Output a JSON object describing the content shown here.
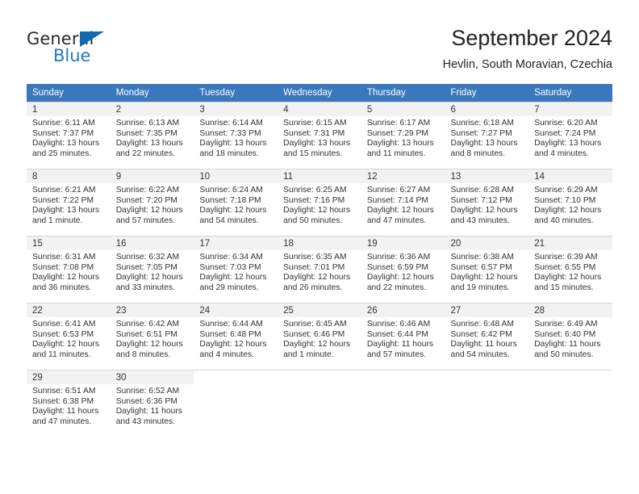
{
  "logo": {
    "text_top": "General",
    "text_bottom": "Blue",
    "triangle_icon": "triangle-icon",
    "color_primary": "#1f7bc1",
    "color_dark": "#2b2b2b"
  },
  "header": {
    "title": "September 2024",
    "subtitle": "Hevlin, South Moravian, Czechia"
  },
  "theme": {
    "header_bg": "#3b77bc",
    "header_text": "#ffffff",
    "daynum_bg": "#f2f2f2",
    "grid_line": "#d5d5d5",
    "body_text": "#333333"
  },
  "weekdays": [
    "Sunday",
    "Monday",
    "Tuesday",
    "Wednesday",
    "Thursday",
    "Friday",
    "Saturday"
  ],
  "weeks": [
    [
      {
        "day": "1",
        "sunrise": "Sunrise: 6:11 AM",
        "sunset": "Sunset: 7:37 PM",
        "daylight1": "Daylight: 13 hours",
        "daylight2": "and 25 minutes."
      },
      {
        "day": "2",
        "sunrise": "Sunrise: 6:13 AM",
        "sunset": "Sunset: 7:35 PM",
        "daylight1": "Daylight: 13 hours",
        "daylight2": "and 22 minutes."
      },
      {
        "day": "3",
        "sunrise": "Sunrise: 6:14 AM",
        "sunset": "Sunset: 7:33 PM",
        "daylight1": "Daylight: 13 hours",
        "daylight2": "and 18 minutes."
      },
      {
        "day": "4",
        "sunrise": "Sunrise: 6:15 AM",
        "sunset": "Sunset: 7:31 PM",
        "daylight1": "Daylight: 13 hours",
        "daylight2": "and 15 minutes."
      },
      {
        "day": "5",
        "sunrise": "Sunrise: 6:17 AM",
        "sunset": "Sunset: 7:29 PM",
        "daylight1": "Daylight: 13 hours",
        "daylight2": "and 11 minutes."
      },
      {
        "day": "6",
        "sunrise": "Sunrise: 6:18 AM",
        "sunset": "Sunset: 7:27 PM",
        "daylight1": "Daylight: 13 hours",
        "daylight2": "and 8 minutes."
      },
      {
        "day": "7",
        "sunrise": "Sunrise: 6:20 AM",
        "sunset": "Sunset: 7:24 PM",
        "daylight1": "Daylight: 13 hours",
        "daylight2": "and 4 minutes."
      }
    ],
    [
      {
        "day": "8",
        "sunrise": "Sunrise: 6:21 AM",
        "sunset": "Sunset: 7:22 PM",
        "daylight1": "Daylight: 13 hours",
        "daylight2": "and 1 minute."
      },
      {
        "day": "9",
        "sunrise": "Sunrise: 6:22 AM",
        "sunset": "Sunset: 7:20 PM",
        "daylight1": "Daylight: 12 hours",
        "daylight2": "and 57 minutes."
      },
      {
        "day": "10",
        "sunrise": "Sunrise: 6:24 AM",
        "sunset": "Sunset: 7:18 PM",
        "daylight1": "Daylight: 12 hours",
        "daylight2": "and 54 minutes."
      },
      {
        "day": "11",
        "sunrise": "Sunrise: 6:25 AM",
        "sunset": "Sunset: 7:16 PM",
        "daylight1": "Daylight: 12 hours",
        "daylight2": "and 50 minutes."
      },
      {
        "day": "12",
        "sunrise": "Sunrise: 6:27 AM",
        "sunset": "Sunset: 7:14 PM",
        "daylight1": "Daylight: 12 hours",
        "daylight2": "and 47 minutes."
      },
      {
        "day": "13",
        "sunrise": "Sunrise: 6:28 AM",
        "sunset": "Sunset: 7:12 PM",
        "daylight1": "Daylight: 12 hours",
        "daylight2": "and 43 minutes."
      },
      {
        "day": "14",
        "sunrise": "Sunrise: 6:29 AM",
        "sunset": "Sunset: 7:10 PM",
        "daylight1": "Daylight: 12 hours",
        "daylight2": "and 40 minutes."
      }
    ],
    [
      {
        "day": "15",
        "sunrise": "Sunrise: 6:31 AM",
        "sunset": "Sunset: 7:08 PM",
        "daylight1": "Daylight: 12 hours",
        "daylight2": "and 36 minutes."
      },
      {
        "day": "16",
        "sunrise": "Sunrise: 6:32 AM",
        "sunset": "Sunset: 7:05 PM",
        "daylight1": "Daylight: 12 hours",
        "daylight2": "and 33 minutes."
      },
      {
        "day": "17",
        "sunrise": "Sunrise: 6:34 AM",
        "sunset": "Sunset: 7:03 PM",
        "daylight1": "Daylight: 12 hours",
        "daylight2": "and 29 minutes."
      },
      {
        "day": "18",
        "sunrise": "Sunrise: 6:35 AM",
        "sunset": "Sunset: 7:01 PM",
        "daylight1": "Daylight: 12 hours",
        "daylight2": "and 26 minutes."
      },
      {
        "day": "19",
        "sunrise": "Sunrise: 6:36 AM",
        "sunset": "Sunset: 6:59 PM",
        "daylight1": "Daylight: 12 hours",
        "daylight2": "and 22 minutes."
      },
      {
        "day": "20",
        "sunrise": "Sunrise: 6:38 AM",
        "sunset": "Sunset: 6:57 PM",
        "daylight1": "Daylight: 12 hours",
        "daylight2": "and 19 minutes."
      },
      {
        "day": "21",
        "sunrise": "Sunrise: 6:39 AM",
        "sunset": "Sunset: 6:55 PM",
        "daylight1": "Daylight: 12 hours",
        "daylight2": "and 15 minutes."
      }
    ],
    [
      {
        "day": "22",
        "sunrise": "Sunrise: 6:41 AM",
        "sunset": "Sunset: 6:53 PM",
        "daylight1": "Daylight: 12 hours",
        "daylight2": "and 11 minutes."
      },
      {
        "day": "23",
        "sunrise": "Sunrise: 6:42 AM",
        "sunset": "Sunset: 6:51 PM",
        "daylight1": "Daylight: 12 hours",
        "daylight2": "and 8 minutes."
      },
      {
        "day": "24",
        "sunrise": "Sunrise: 6:44 AM",
        "sunset": "Sunset: 6:48 PM",
        "daylight1": "Daylight: 12 hours",
        "daylight2": "and 4 minutes."
      },
      {
        "day": "25",
        "sunrise": "Sunrise: 6:45 AM",
        "sunset": "Sunset: 6:46 PM",
        "daylight1": "Daylight: 12 hours",
        "daylight2": "and 1 minute."
      },
      {
        "day": "26",
        "sunrise": "Sunrise: 6:46 AM",
        "sunset": "Sunset: 6:44 PM",
        "daylight1": "Daylight: 11 hours",
        "daylight2": "and 57 minutes."
      },
      {
        "day": "27",
        "sunrise": "Sunrise: 6:48 AM",
        "sunset": "Sunset: 6:42 PM",
        "daylight1": "Daylight: 11 hours",
        "daylight2": "and 54 minutes."
      },
      {
        "day": "28",
        "sunrise": "Sunrise: 6:49 AM",
        "sunset": "Sunset: 6:40 PM",
        "daylight1": "Daylight: 11 hours",
        "daylight2": "and 50 minutes."
      }
    ],
    [
      {
        "day": "29",
        "sunrise": "Sunrise: 6:51 AM",
        "sunset": "Sunset: 6:38 PM",
        "daylight1": "Daylight: 11 hours",
        "daylight2": "and 47 minutes."
      },
      {
        "day": "30",
        "sunrise": "Sunrise: 6:52 AM",
        "sunset": "Sunset: 6:36 PM",
        "daylight1": "Daylight: 11 hours",
        "daylight2": "and 43 minutes."
      },
      {
        "day": "",
        "sunrise": "",
        "sunset": "",
        "daylight1": "",
        "daylight2": ""
      },
      {
        "day": "",
        "sunrise": "",
        "sunset": "",
        "daylight1": "",
        "daylight2": ""
      },
      {
        "day": "",
        "sunrise": "",
        "sunset": "",
        "daylight1": "",
        "daylight2": ""
      },
      {
        "day": "",
        "sunrise": "",
        "sunset": "",
        "daylight1": "",
        "daylight2": ""
      },
      {
        "day": "",
        "sunrise": "",
        "sunset": "",
        "daylight1": "",
        "daylight2": ""
      }
    ]
  ]
}
